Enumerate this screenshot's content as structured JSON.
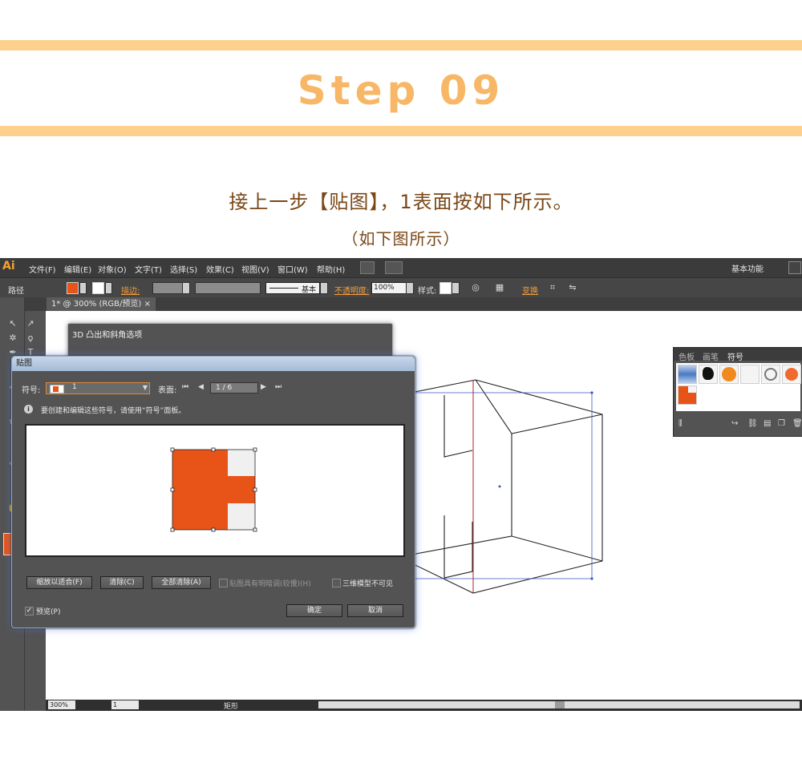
{
  "header": {
    "step_title": "Step 09",
    "caption_main": "接上一步【贴图】，1表面按如下所示。",
    "caption_sub": "（如下图所示）"
  },
  "colors": {
    "band": "#fdd08e",
    "title": "#f7b766",
    "caption": "#7a4716",
    "accent_orange": "#e85418"
  },
  "app": {
    "logo": "Ai",
    "menu": [
      "文件(F)",
      "编辑(E)",
      "对象(O)",
      "文字(T)",
      "选择(S)",
      "效果(C)",
      "视图(V)",
      "窗口(W)",
      "帮助(H)"
    ],
    "workspace": "基本功能",
    "control": {
      "object_type": "路径",
      "stroke_label": "描边:",
      "stroke_style": "基本",
      "opacity_label": "不透明度:",
      "opacity_value": "100%",
      "style_label": "样式:",
      "transform_label": "变换"
    },
    "doc_tab": "1* @ 300% (RGB/预览)",
    "status": {
      "zoom": "300%",
      "page": "1",
      "tool_label": "矩形"
    }
  },
  "symbols_panel": {
    "tabs": [
      "色板",
      "画笔",
      "符号"
    ],
    "active_tab": "符号"
  },
  "dialog_3d": {
    "title": "3D 凸出和斜角选项"
  },
  "map_art": {
    "title": "贴图",
    "symbol_label": "符号:",
    "symbol_value": "1",
    "surface_label": "表面:",
    "surface_value": "1 / 6",
    "info_text": "要创建和编辑这些符号，请使用“符号”面板。",
    "btn_fit": "缩放以适合(F)",
    "btn_clear": "清除(C)",
    "btn_clear_all": "全部清除(A)",
    "chk_shade": "贴图具有明暗调(较慢)(H)",
    "chk_invisible": "三维模型不可见",
    "chk_preview": "预览(P)",
    "btn_ok": "确定",
    "btn_cancel": "取消"
  }
}
